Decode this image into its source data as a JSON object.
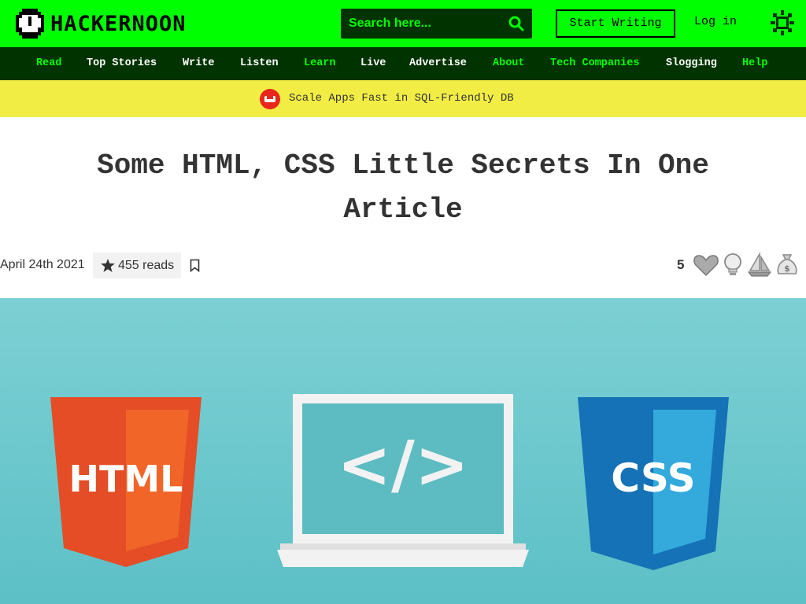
{
  "header": {
    "logo_text": "HACKERNOON",
    "search_placeholder": "Search here...",
    "start_writing_label": "Start Writing",
    "login_label": "Log in"
  },
  "nav": {
    "items": [
      {
        "label": "Read",
        "color": "#00ff00"
      },
      {
        "label": "Top Stories",
        "color": "#ffffff"
      },
      {
        "label": "Write",
        "color": "#ffffff"
      },
      {
        "label": "Listen",
        "color": "#ffffff"
      },
      {
        "label": "Learn",
        "color": "#00ff00"
      },
      {
        "label": "Live",
        "color": "#ffffff"
      },
      {
        "label": "Advertise",
        "color": "#ffffff"
      },
      {
        "label": "About",
        "color": "#00ff00"
      },
      {
        "label": "Tech Companies",
        "color": "#00ff00"
      },
      {
        "label": "Slogging",
        "color": "#ffffff"
      },
      {
        "label": "Help",
        "color": "#00ff00"
      }
    ]
  },
  "banner": {
    "text": "Scale Apps Fast in SQL-Friendly DB",
    "icon": "couchbase-logo-icon"
  },
  "article": {
    "title": "Some HTML, CSS Little Secrets In One Article",
    "date": "April 24th 2021",
    "reads": "455 reads",
    "reaction_count": "5",
    "reactions": [
      "heart-icon",
      "lightbulb-icon",
      "boat-icon",
      "money-bag-icon"
    ]
  },
  "hero": {
    "html_badge": "HTML",
    "code_symbol": "</>",
    "css_badge": "CSS"
  },
  "colors": {
    "brand_green": "#00ff00",
    "dark_green": "#003300",
    "banner_yellow": "#f2ed44",
    "hero_teal": "#6cc8cc"
  }
}
